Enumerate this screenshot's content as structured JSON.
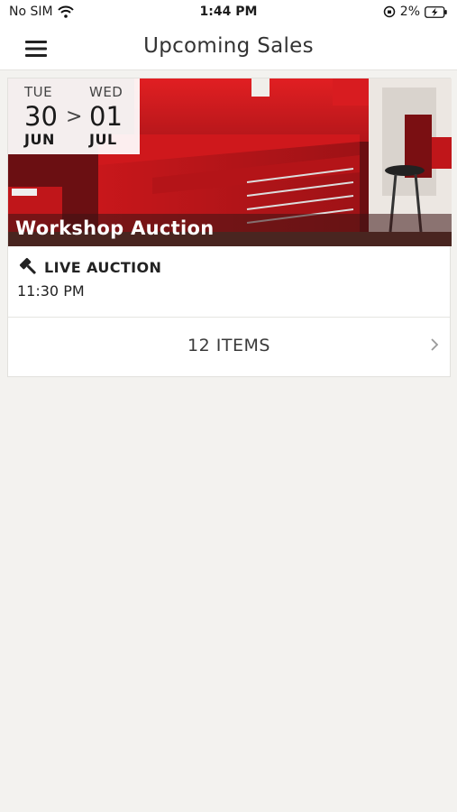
{
  "status_bar": {
    "carrier": "No SIM",
    "time": "1:44 PM",
    "battery_percent": "2%"
  },
  "nav": {
    "title": "Upcoming Sales"
  },
  "sale": {
    "start": {
      "dow": "TUE",
      "day": "30",
      "month": "JUN"
    },
    "separator": ">",
    "end": {
      "dow": "WED",
      "day": "01",
      "month": "JUL"
    },
    "title": "Workshop Auction",
    "type": "LIVE AUCTION",
    "time": "11:30 PM",
    "items_label": "12 ITEMS"
  },
  "colors": {
    "background": "#f3f2ef",
    "card": "#ffffff",
    "hero_red": "#c8171b"
  },
  "icons": [
    "wifi-icon",
    "orientation-lock-icon",
    "battery-charging-icon",
    "hamburger-menu-icon",
    "gavel-icon",
    "chevron-right-icon"
  ]
}
